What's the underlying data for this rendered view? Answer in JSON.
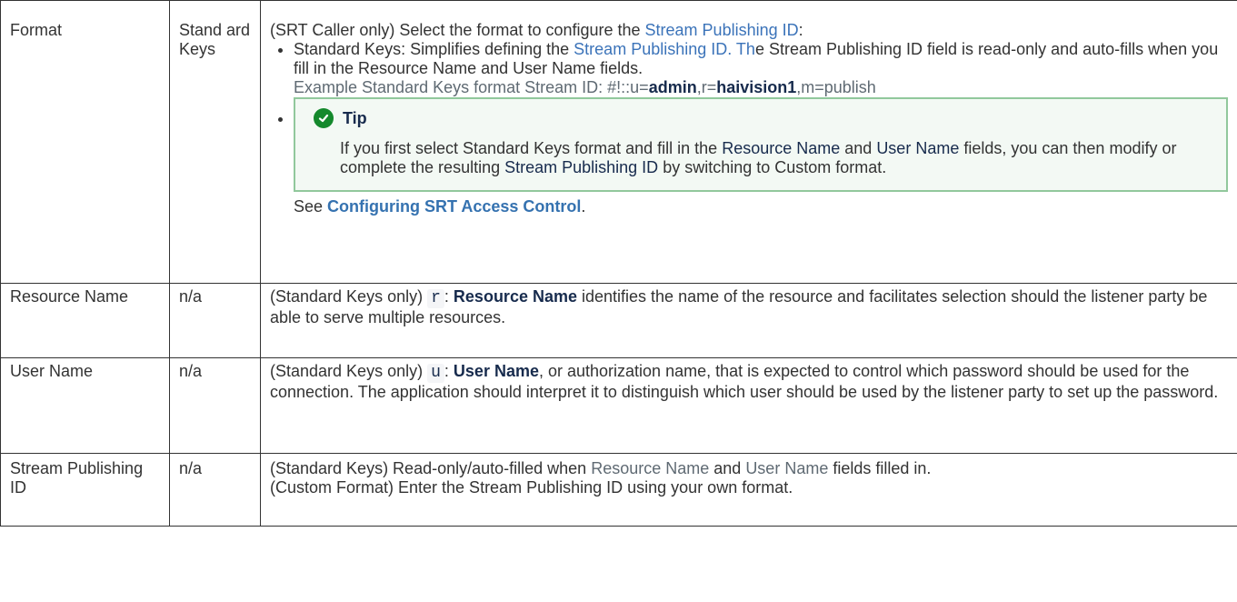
{
  "rows": [
    {
      "name": "Format",
      "default": "Stand ard Keys",
      "desc": {
        "intro_prefix": "(SRT Caller only) Select the format to configure the ",
        "intro_link": "Stream Publishing ID",
        "intro_suffix": ":",
        "bullet1": {
          "prefix": "Standard Keys: Simplifies defining the ",
          "link": "Stream Publishing ID. Th",
          "mid": "e Stream Publishing ID field is read-only and auto-fills when you fill in the Resource Name and User Name fields.",
          "example_prefix": "Example Standard Keys format Stream ID: ",
          "ex_a": "#!::u=",
          "ex_b": "admin",
          "ex_c": ",r=",
          "ex_d": "haivision1",
          "ex_e": ",m=publish"
        },
        "tip": {
          "title": "Tip",
          "p1": "If you first select Standard Keys format and fill in the ",
          "p1_em1": "Resource Name",
          "p2": " and ",
          "p2_em2": "User Name",
          "p3": " fields, you can then modify or complete the resulting ",
          "p3_em3": "Stream Publishing ID",
          "p4": " by switching to Custom format."
        },
        "see_prefix": "See ",
        "see_link": "Configuring SRT Access Control",
        "see_suffix": "."
      }
    },
    {
      "name": "Resource Name",
      "default": "n/a",
      "desc": {
        "prefix": "(Standard Keys only) ",
        "code": "r",
        "colon": ": ",
        "strong": "Resource Name",
        "rest": " identifies the name of the resource and facilitates selection should the listener party be able to serve multiple resources."
      }
    },
    {
      "name": "User Name",
      "default": "n/a",
      "desc": {
        "prefix": "(Standard Keys only) ",
        "code": "u",
        "colon": ": ",
        "strong": "User Name",
        "rest": ", or authorization name, that is expected to control which password should be used for the connection. The application should interpret it to distinguish which user should be used by the listener party to set up the password."
      }
    },
    {
      "name": "Stream Publishing ID",
      "default": "n/a",
      "desc": {
        "l1_prefix": "(Standard Keys) Read-only/auto-filled when ",
        "l1_a": "Resource Name",
        "l1_and": " and ",
        "l1_b": "User Name",
        "l1_suffix": " fields filled in.",
        "l2": "(Custom Format) Enter the Stream Publishing ID using your own format."
      }
    }
  ],
  "icons": {
    "tip": "check-circle-icon"
  },
  "colors": {
    "tip_border": "#91c89c",
    "tip_bg": "#f3f9f4",
    "tip_icon": "#14892c",
    "link": "#3572b0"
  }
}
